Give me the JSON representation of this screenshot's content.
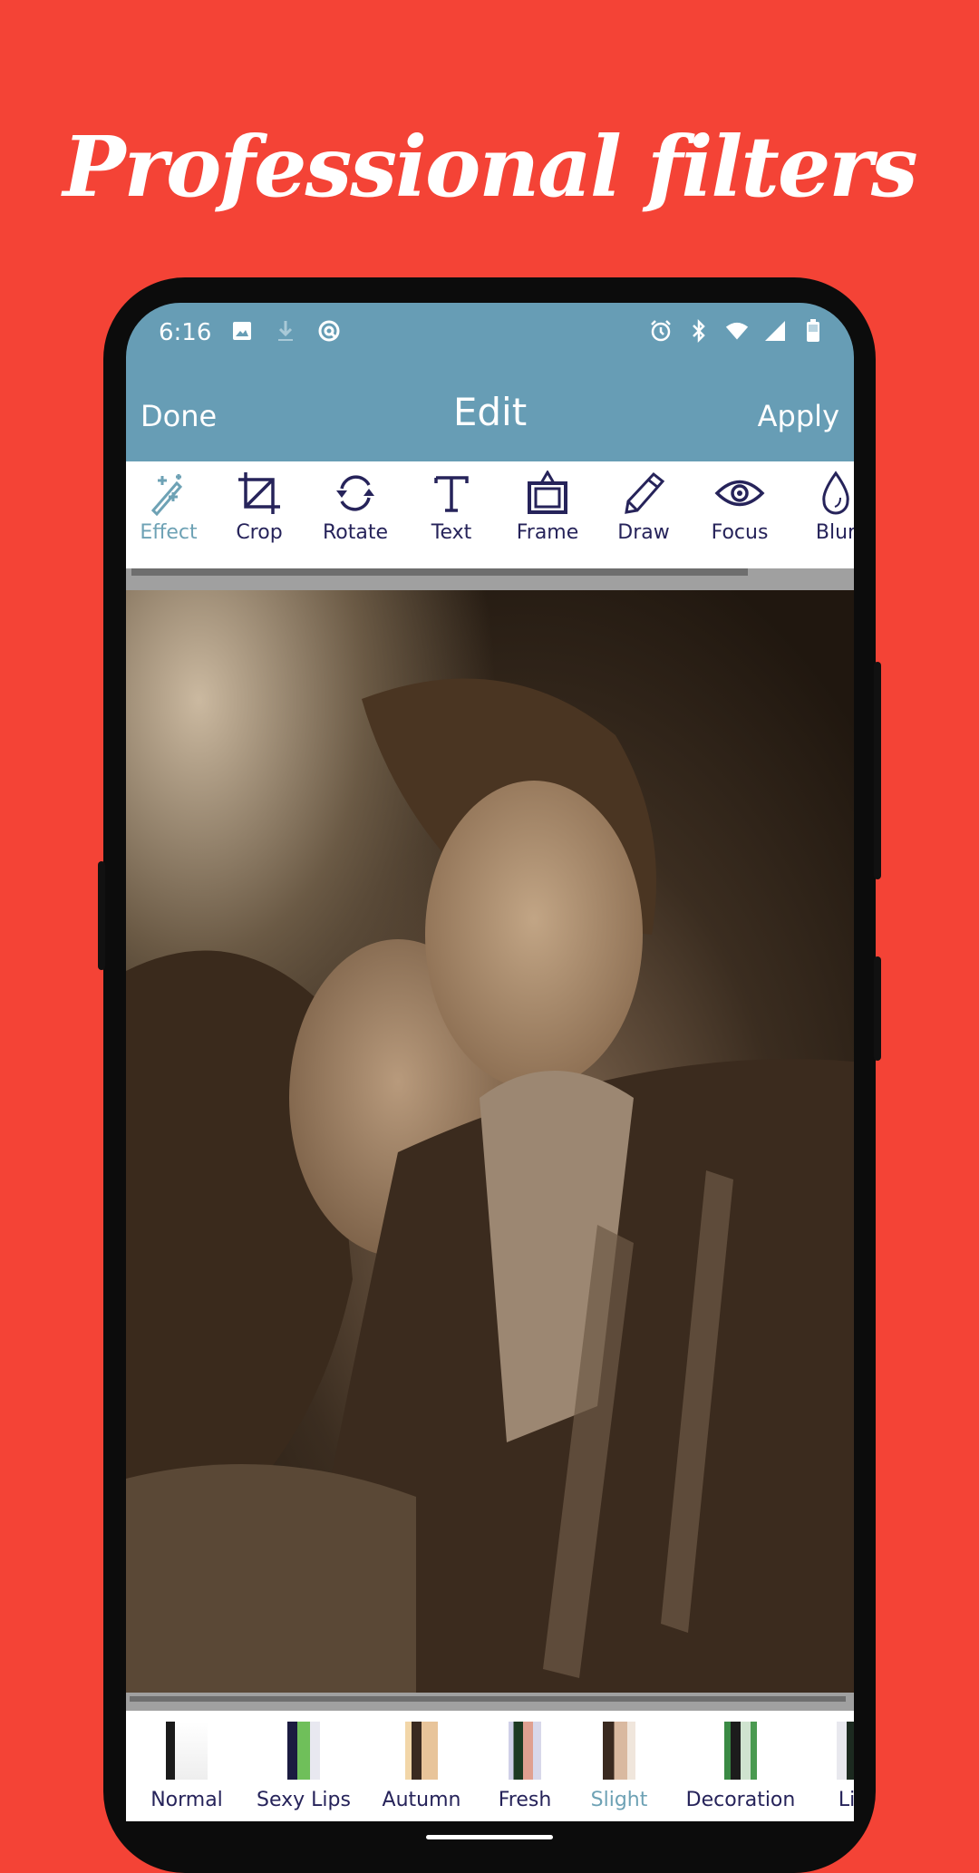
{
  "promo": {
    "headline": "Professional filters",
    "background_color": "#f44336"
  },
  "status_bar": {
    "time": "6:16",
    "left_icons": [
      "image-icon",
      "download-icon",
      "data-saver-icon"
    ],
    "right_icons": [
      "alarm-icon",
      "bluetooth-icon",
      "wifi-icon",
      "signal-icon",
      "battery-icon"
    ]
  },
  "app_bar": {
    "done_label": "Done",
    "title": "Edit",
    "apply_label": "Apply",
    "color": "#679db5"
  },
  "tools": [
    {
      "label": "Effect",
      "icon": "magic-wand-icon",
      "active": true
    },
    {
      "label": "Crop",
      "icon": "crop-icon"
    },
    {
      "label": "Rotate",
      "icon": "rotate-icon"
    },
    {
      "label": "Text",
      "icon": "text-icon"
    },
    {
      "label": "Frame",
      "icon": "frame-icon"
    },
    {
      "label": "Draw",
      "icon": "pencil-icon"
    },
    {
      "label": "Focus",
      "icon": "eye-icon"
    },
    {
      "label": "Blur",
      "icon": "droplet-icon"
    }
  ],
  "photo": {
    "description": "Sepia-toned photo of a smiling couple touching foreheads"
  },
  "filters": [
    {
      "label": "Normal"
    },
    {
      "label": "Sexy Lips"
    },
    {
      "label": "Autumn"
    },
    {
      "label": "Fresh"
    },
    {
      "label": "Slight",
      "active": true
    },
    {
      "label": "Decoration"
    },
    {
      "label": "Lig"
    }
  ],
  "colors": {
    "accent": "#6ea2b5",
    "text_dark": "#26235a"
  }
}
